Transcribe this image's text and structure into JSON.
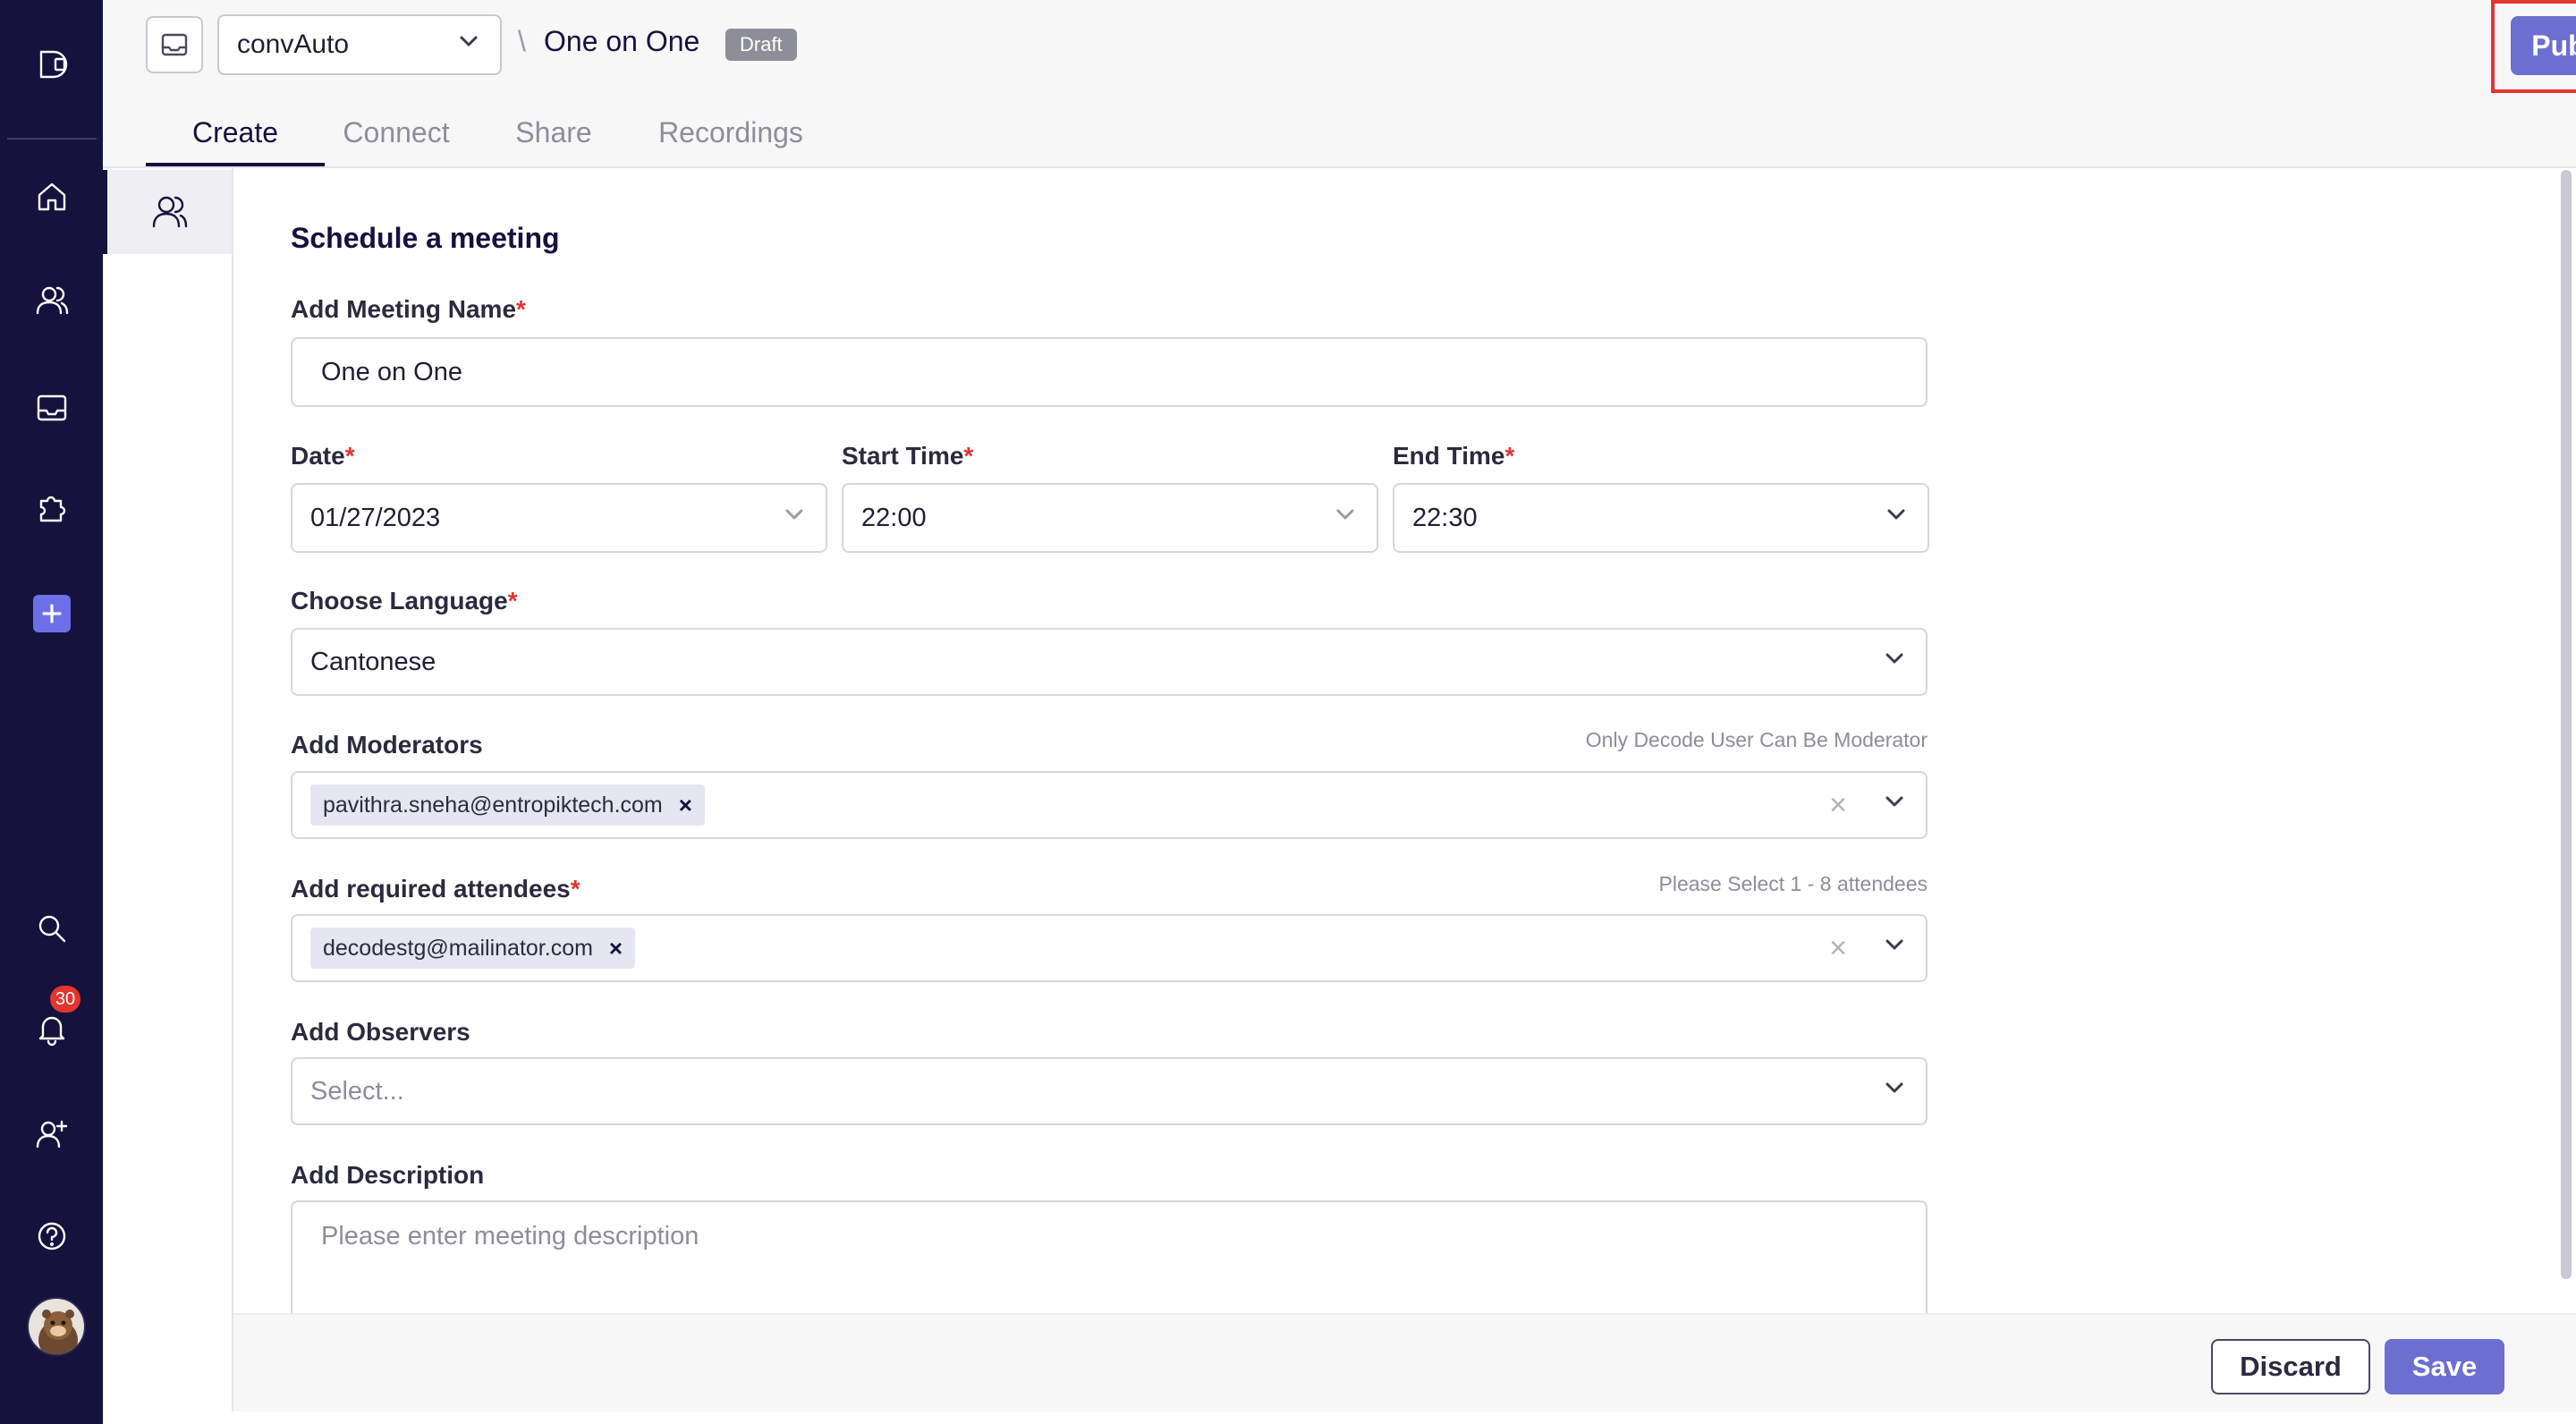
{
  "header": {
    "workspace": "convAuto",
    "separator": "\\",
    "meeting_title": "One on One",
    "status_badge": "Draft",
    "publish_label": "Publish"
  },
  "tabs": [
    {
      "label": "Create",
      "active": true
    },
    {
      "label": "Connect",
      "active": false
    },
    {
      "label": "Share",
      "active": false
    },
    {
      "label": "Recordings",
      "active": false
    }
  ],
  "nav": {
    "items": [
      "logo-icon",
      "home-icon",
      "users-icon",
      "inbox-icon",
      "puzzle-icon",
      "plus-icon",
      "search-icon",
      "bell-icon",
      "add-user-icon",
      "help-icon"
    ],
    "notification_count": "30"
  },
  "form": {
    "section_title": "Schedule a meeting",
    "required_mark": "*",
    "meeting_name": {
      "label": "Add Meeting Name",
      "value": "One on One"
    },
    "date": {
      "label": "Date",
      "value": "01/27/2023"
    },
    "start_time": {
      "label": "Start Time",
      "value": "22:00"
    },
    "end_time": {
      "label": "End Time",
      "value": "22:30"
    },
    "language": {
      "label": "Choose Language",
      "value": "Cantonese"
    },
    "moderators": {
      "label": "Add Moderators",
      "hint": "Only Decode User Can Be Moderator",
      "chips": [
        "pavithra.sneha@entropiktech.com"
      ]
    },
    "attendees": {
      "label": "Add required attendees",
      "hint": "Please Select 1 - 8 attendees",
      "chips": [
        "decodestg@mailinator.com"
      ]
    },
    "observers": {
      "label": "Add Observers",
      "placeholder": "Select..."
    },
    "description": {
      "label": "Add Description",
      "placeholder": "Please enter meeting description"
    }
  },
  "footer": {
    "discard_label": "Discard",
    "save_label": "Save"
  },
  "colors": {
    "nav_bg": "#15123d",
    "accent": "#6c6fcf",
    "required": "#e3342f",
    "highlight_box": "#e3342f"
  }
}
